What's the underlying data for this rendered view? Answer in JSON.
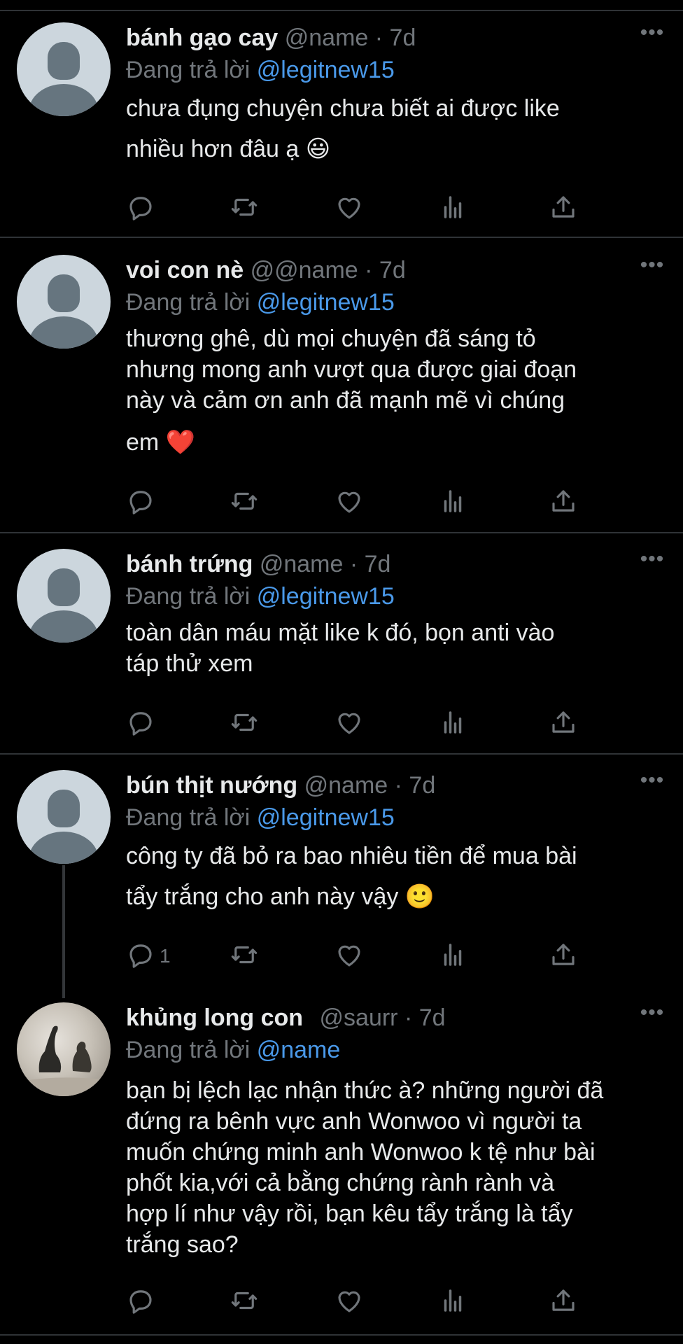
{
  "tweets": [
    {
      "display_name": "bánh gạo cay",
      "handle": "@name",
      "dot": "·",
      "time": "7d",
      "reply_prefix": "Đang trả lời",
      "reply_target": "@legitnew15",
      "text_lines": [
        "chưa đụng chuyện chưa biết ai được like",
        "nhiều hơn đâu ạ 😃"
      ],
      "reply_count": ""
    },
    {
      "display_name": "voi con nè",
      "handle": "@@name",
      "dot": "·",
      "time": "7d",
      "reply_prefix": "Đang trả lời",
      "reply_target": "@legitnew15",
      "text_lines": [
        "thương ghê, dù mọi chuyện đã sáng tỏ",
        "nhưng mong anh vượt qua được giai đoạn",
        "này và cảm ơn anh đã mạnh mẽ vì chúng",
        "em ❤️"
      ],
      "reply_count": ""
    },
    {
      "display_name": "bánh trứng",
      "handle": "@name",
      "dot": "·",
      "time": "7d",
      "reply_prefix": "Đang trả lời",
      "reply_target": "@legitnew15",
      "text_lines": [
        "toàn dân máu mặt like k đó, bọn anti vào",
        "táp thử xem"
      ],
      "reply_count": ""
    },
    {
      "display_name": "bún thịt nướng",
      "handle": "@name",
      "dot": "·",
      "time": "7d",
      "reply_prefix": "Đang trả lời",
      "reply_target": "@legitnew15",
      "text_lines": [
        "công ty đã bỏ ra bao nhiêu tiền để mua bài",
        "tẩy trắng cho anh này vậy 🙂"
      ],
      "reply_count": "1"
    },
    {
      "display_name": "khủng long con",
      "handle": "@saurr",
      "dot": "·",
      "time": "7d",
      "reply_prefix": "Đang trả lời",
      "reply_target": "@name",
      "text_lines": [
        "bạn bị lệch lạc nhận thức à? những người đã",
        "đứng ra bênh vực anh Wonwoo vì người ta",
        "muốn chứng minh anh Wonwoo k tệ như bài",
        "phốt kia,với cả bằng chứng rành rành và",
        "hợp lí như vậy rồi, bạn kêu tẩy trắng là tẩy",
        "trắng sao?"
      ],
      "reply_count": ""
    }
  ],
  "icons": [
    "reply-icon",
    "retweet-icon",
    "like-icon",
    "analytics-icon",
    "share-icon",
    "more-icon"
  ],
  "colors": {
    "background": "#000000",
    "text": "#e7e9ea",
    "muted": "#71767b",
    "link": "#4a99e9",
    "divider": "#2f3336"
  }
}
